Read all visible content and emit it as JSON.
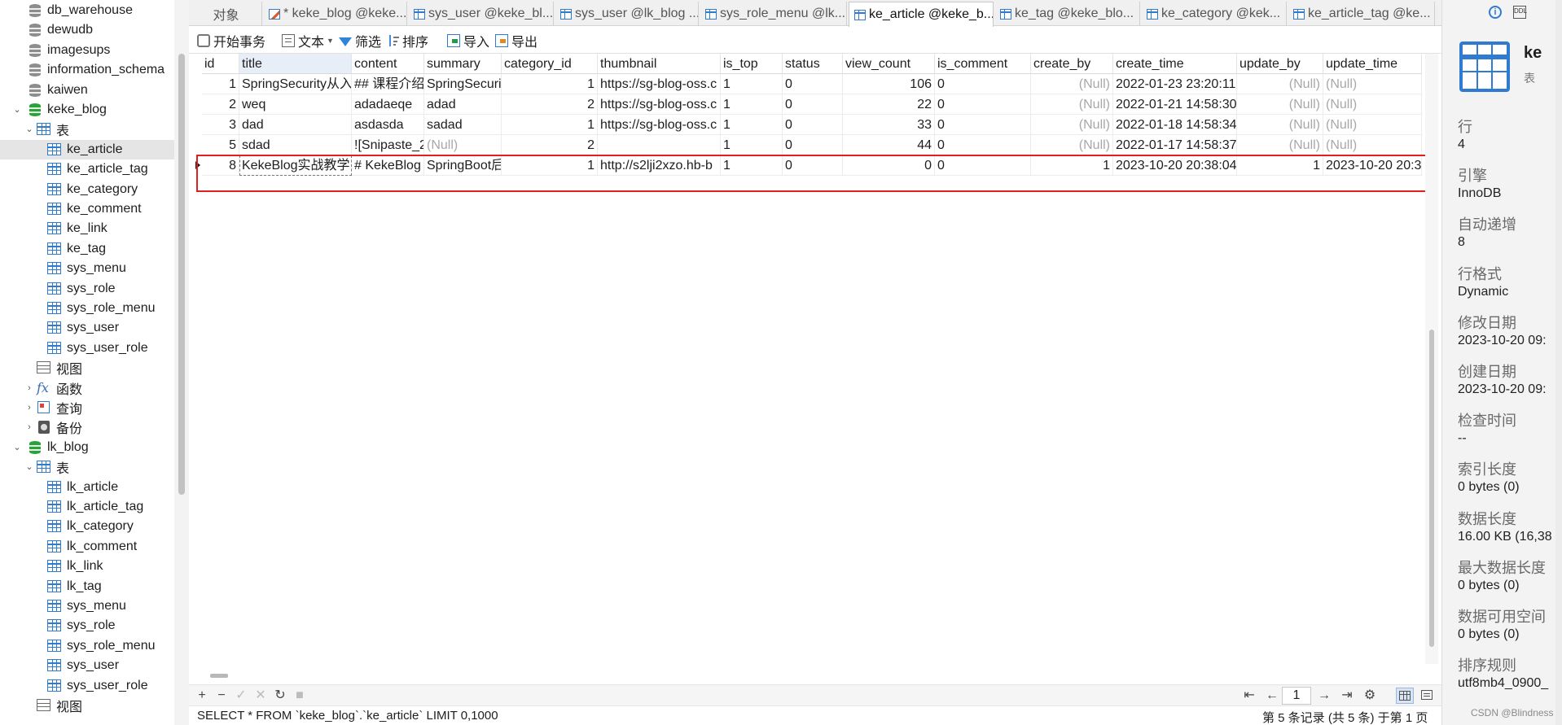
{
  "navigator": {
    "rows": [
      {
        "label": "db_warehouse",
        "icon": "database-gray-icon",
        "level": 0
      },
      {
        "label": "dewudb",
        "icon": "database-gray-icon",
        "level": 0
      },
      {
        "label": "imagesups",
        "icon": "database-gray-icon",
        "level": 0
      },
      {
        "label": "information_schema",
        "icon": "database-gray-icon",
        "level": 0
      },
      {
        "label": "kaiwen",
        "icon": "database-gray-icon",
        "level": 0
      },
      {
        "label": "keke_blog",
        "icon": "database-green-icon",
        "level": 0,
        "expanded": true
      },
      {
        "label": "表",
        "icon": "tables-folder-icon",
        "level": 1,
        "expanded": true
      },
      {
        "label": "ke_article",
        "icon": "table-icon",
        "level": 2,
        "selected": true
      },
      {
        "label": "ke_article_tag",
        "icon": "table-icon",
        "level": 2
      },
      {
        "label": "ke_category",
        "icon": "table-icon",
        "level": 2
      },
      {
        "label": "ke_comment",
        "icon": "table-icon",
        "level": 2
      },
      {
        "label": "ke_link",
        "icon": "table-icon",
        "level": 2
      },
      {
        "label": "ke_tag",
        "icon": "table-icon",
        "level": 2
      },
      {
        "label": "sys_menu",
        "icon": "table-icon",
        "level": 2
      },
      {
        "label": "sys_role",
        "icon": "table-icon",
        "level": 2
      },
      {
        "label": "sys_role_menu",
        "icon": "table-icon",
        "level": 2
      },
      {
        "label": "sys_user",
        "icon": "table-icon",
        "level": 2
      },
      {
        "label": "sys_user_role",
        "icon": "table-icon",
        "level": 2
      },
      {
        "label": "视图",
        "icon": "views-folder-icon",
        "level": 1
      },
      {
        "label": "函数",
        "icon": "function-icon",
        "level": 1,
        "expanded": false
      },
      {
        "label": "查询",
        "icon": "query-icon",
        "level": 1,
        "expanded": false
      },
      {
        "label": "备份",
        "icon": "backup-icon",
        "level": 1,
        "expanded": false
      },
      {
        "label": "lk_blog",
        "icon": "database-green-icon",
        "level": 0,
        "expanded": true
      },
      {
        "label": "表",
        "icon": "tables-folder-icon",
        "level": 1,
        "expanded": true
      },
      {
        "label": "lk_article",
        "icon": "table-icon",
        "level": 2
      },
      {
        "label": "lk_article_tag",
        "icon": "table-icon",
        "level": 2
      },
      {
        "label": "lk_category",
        "icon": "table-icon",
        "level": 2
      },
      {
        "label": "lk_comment",
        "icon": "table-icon",
        "level": 2
      },
      {
        "label": "lk_link",
        "icon": "table-icon",
        "level": 2
      },
      {
        "label": "lk_tag",
        "icon": "table-icon",
        "level": 2
      },
      {
        "label": "sys_menu",
        "icon": "table-icon",
        "level": 2
      },
      {
        "label": "sys_role",
        "icon": "table-icon",
        "level": 2
      },
      {
        "label": "sys_role_menu",
        "icon": "table-icon",
        "level": 2
      },
      {
        "label": "sys_user",
        "icon": "table-icon",
        "level": 2
      },
      {
        "label": "sys_user_role",
        "icon": "table-icon",
        "level": 2
      },
      {
        "label": "视图",
        "icon": "views-folder-icon",
        "level": 1
      }
    ]
  },
  "tabs": [
    {
      "label": "对象",
      "icon": "none"
    },
    {
      "label": "* keke_blog @keke...",
      "icon": "query-edit-icon"
    },
    {
      "label": "sys_user @keke_bl...",
      "icon": "table-icon"
    },
    {
      "label": "sys_user @lk_blog ...",
      "icon": "table-icon"
    },
    {
      "label": "sys_role_menu @lk...",
      "icon": "table-icon"
    },
    {
      "label": "ke_article @keke_b...",
      "icon": "table-icon",
      "active": true
    },
    {
      "label": "ke_tag @keke_blo...",
      "icon": "table-icon"
    },
    {
      "label": "ke_category @kek...",
      "icon": "table-icon"
    },
    {
      "label": "ke_article_tag @ke...",
      "icon": "table-icon"
    }
  ],
  "toolbar": {
    "begin_transaction": "开始事务",
    "text": "文本",
    "filter": "筛选",
    "sort": "排序",
    "import": "导入",
    "export": "导出"
  },
  "grid": {
    "columns": [
      "id",
      "title",
      "content",
      "summary",
      "category_id",
      "thumbnail",
      "is_top",
      "status",
      "view_count",
      "is_comment",
      "create_by",
      "create_time",
      "update_by",
      "update_time"
    ],
    "rows": [
      [
        "1",
        "SpringSecurity从入",
        "## 课程介绍",
        "SpringSecuri",
        "1",
        "https://sg-blog-oss.c",
        "1",
        "0",
        "106",
        "0",
        "(Null)",
        "2022-01-23 23:20:11",
        "(Null)",
        "(Null)"
      ],
      [
        "2",
        "weq",
        "adadaeqe",
        "adad",
        "2",
        "https://sg-blog-oss.c",
        "1",
        "0",
        "22",
        "0",
        "(Null)",
        "2022-01-21 14:58:30",
        "(Null)",
        "(Null)"
      ],
      [
        "3",
        "dad",
        "asdasda",
        "sadad",
        "1",
        "https://sg-blog-oss.c",
        "1",
        "0",
        "33",
        "0",
        "(Null)",
        "2022-01-18 14:58:34",
        "(Null)",
        "(Null)"
      ],
      [
        "5",
        "sdad",
        "![Snipaste_2",
        "(Null)",
        "2",
        "",
        "1",
        "0",
        "44",
        "0",
        "(Null)",
        "2022-01-17 14:58:37",
        "(Null)",
        "(Null)"
      ],
      [
        "8",
        "KekeBlog实战教学",
        "# KekeBlog",
        "SpringBoot后",
        "1",
        "http://s2lji2xzo.hb-b",
        "1",
        "0",
        "0",
        "0",
        "1",
        "2023-10-20 20:38:04",
        "1",
        "2023-10-20 20:3"
      ]
    ]
  },
  "bottombar": {
    "page": "1",
    "buttons": [
      "add-row",
      "delete-row",
      "apply",
      "discard",
      "refresh",
      "stop"
    ]
  },
  "statusbar": {
    "sql": "SELECT * FROM `keke_blog`.`ke_article` LIMIT 0,1000",
    "records": "第 5 条记录 (共 5 条) 于第 1 页"
  },
  "info": {
    "name": "ke",
    "subtitle": "表",
    "fields": [
      {
        "label": "行",
        "value": "4"
      },
      {
        "label": "引擎",
        "value": "InnoDB"
      },
      {
        "label": "自动递增",
        "value": "8"
      },
      {
        "label": "行格式",
        "value": "Dynamic"
      },
      {
        "label": "修改日期",
        "value": "2023-10-20 09:"
      },
      {
        "label": "创建日期",
        "value": "2023-10-20 09:"
      },
      {
        "label": "检查时间",
        "value": "--"
      },
      {
        "label": "索引长度",
        "value": "0 bytes (0)"
      },
      {
        "label": "数据长度",
        "value": "16.00 KB (16,38"
      },
      {
        "label": "最大数据长度",
        "value": "0 bytes (0)"
      },
      {
        "label": "数据可用空间",
        "value": "0 bytes (0)"
      },
      {
        "label": "排序规则",
        "value": "utf8mb4_0900_"
      }
    ],
    "watermark": "CSDN @Blindness"
  },
  "colors": {
    "highlight_border": "#e02020",
    "accent": "#2f7bd1",
    "db_active": "#2ca13a"
  }
}
